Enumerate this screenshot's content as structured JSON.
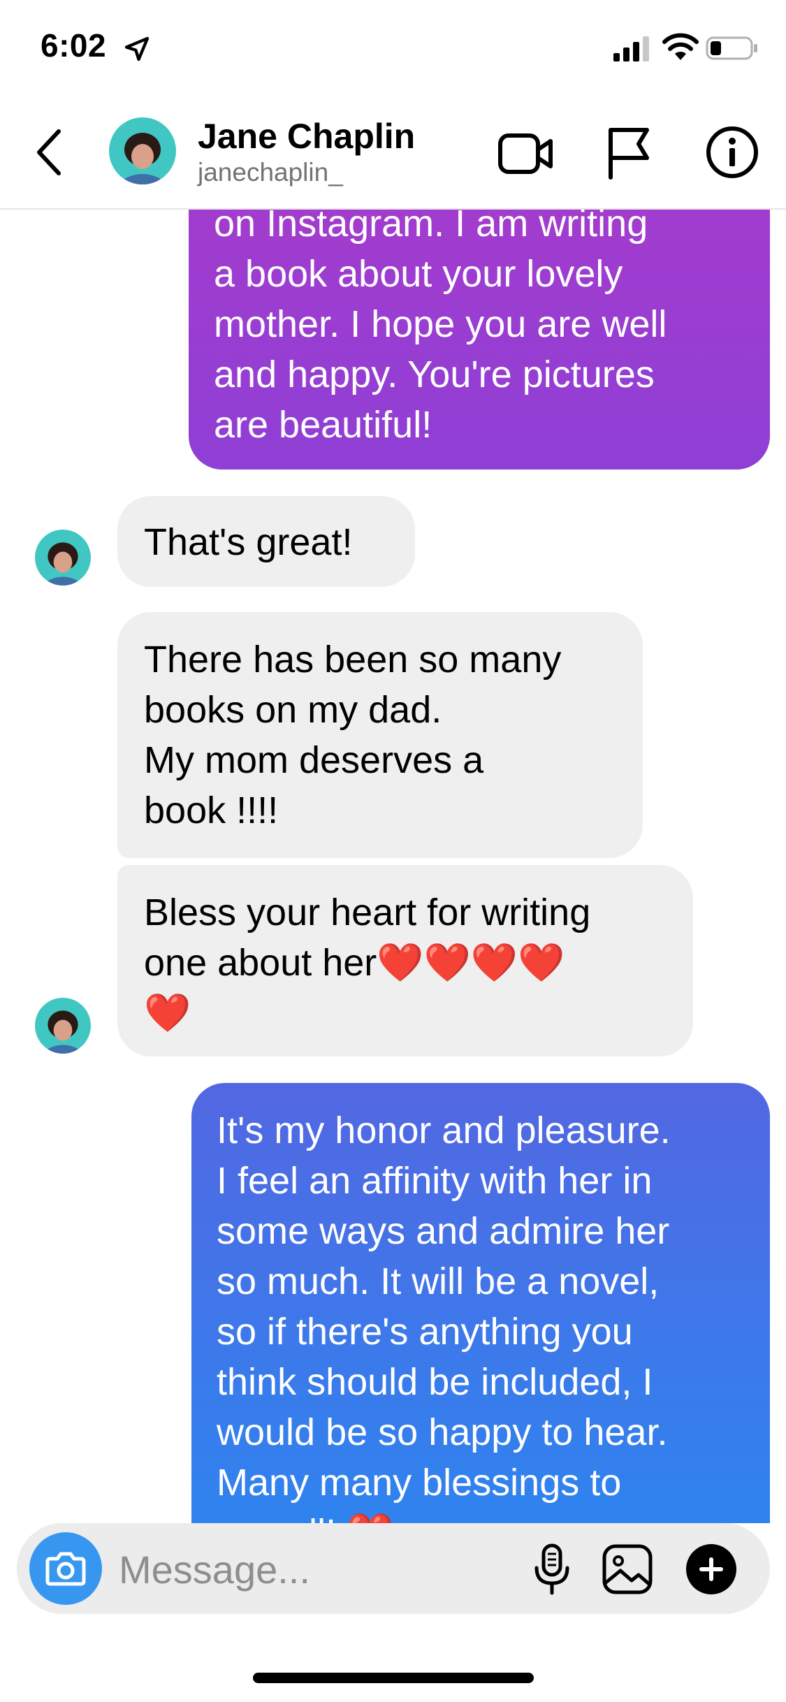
{
  "status_bar": {
    "time": "6:02",
    "icons": [
      "location-arrow-icon",
      "cellular-signal-icon",
      "wifi-icon",
      "battery-icon"
    ]
  },
  "header": {
    "contact_name": "Jane Chaplin",
    "contact_handle": "janechaplin_",
    "icons": [
      "back-chevron-icon",
      "video-camera-icon",
      "flag-icon",
      "info-icon"
    ]
  },
  "messages": [
    {
      "direction": "outgoing",
      "text": "on Instagram. I am writing\na book about your lovely\nmother. I hope you are well\nand happy. You're pictures\nare beautiful!"
    },
    {
      "direction": "incoming",
      "text": "That's great!"
    },
    {
      "direction": "incoming",
      "text": "There has been so many\nbooks on my dad.\nMy mom deserves a\nbook  !!!!"
    },
    {
      "direction": "incoming",
      "text": "Bless your heart for writing\none about her❤️❤️❤️❤️\n❤️"
    },
    {
      "direction": "outgoing",
      "text": "It's my honor and pleasure.\nI feel an affinity with her in\nsome ways and admire her\nso much. It will be a novel,\nso if there's anything you\nthink should be included, I\nwould be so happy to hear.\nMany many blessings to\nyou all! ❤️"
    }
  ],
  "composer": {
    "placeholder": "Message...",
    "value": "",
    "icons": [
      "camera-icon",
      "microphone-icon",
      "gallery-icon",
      "plus-icon"
    ]
  },
  "colors": {
    "outgoing_purple": "#9b3dd1",
    "outgoing_blue": "#3a7cec",
    "incoming_bubble": "#efefef",
    "camera_button": "#3797f0"
  }
}
